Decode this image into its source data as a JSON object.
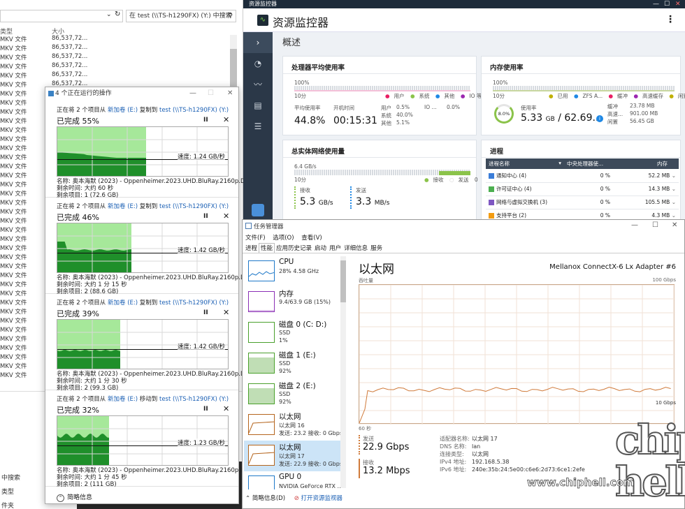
{
  "explorer": {
    "search_placeholder": "在 test (\\\\TS-h1290FX) (Y:) 中搜索",
    "col_type": "类型",
    "col_size": "大小",
    "file_type": "MKV 文件",
    "file_size": "86,537,72...",
    "left_labels": [
      "中搜索",
      "类型",
      "件夹"
    ]
  },
  "copy": {
    "title": "4 个正在运行的操作",
    "ops": [
      {
        "line_a": "正在将 2 个项目从 ",
        "src": "新加卷 (E:)",
        "verb": " 复制到 ",
        "dst": "test (\\\\TS-h1290FX) (Y:)",
        "pct": "已完成 55%",
        "progress": 0.55,
        "speed": "速度: 1.24 GB/秒",
        "name": "名称: 奥本海默 (2023) - Oppenheimer.2023.UHD.BluRay.2160p.DTS-...",
        "remain_time": "剩余时间: 大约 60 秒",
        "remain_items": "剩余项目: 1 (72.6 GB)"
      },
      {
        "line_a": "正在将 2 个项目从 ",
        "src": "新加卷 (E:)",
        "verb": " 复制到 ",
        "dst": "test (\\\\TS-h1290FX) (Y:)",
        "pct": "已完成 46%",
        "progress": 0.46,
        "speed": "速度: 1.42 GB/秒",
        "name": "名称: 奥本海默 (2023) - Oppenheimer.2023.UHD.BluRay.2160p.DTS-...",
        "remain_time": "剩余时间: 大约 1 分 15 秒",
        "remain_items": "剩余项目: 2 (88.6 GB)"
      },
      {
        "line_a": "正在将 2 个项目从 ",
        "src": "新加卷 (E:)",
        "verb": " 复制到 ",
        "dst": "test (\\\\TS-h1290FX) (Y:)",
        "pct": "已完成 39%",
        "progress": 0.39,
        "speed": "速度: 1.42 GB/秒",
        "name": "名称: 奥本海默 (2023) - Oppenheimer.2023.UHD.BluRay.2160p.DTS-...",
        "remain_time": "剩余时间: 大约 1 分 30 秒",
        "remain_items": "剩余项目: 2 (99.3 GB)"
      },
      {
        "line_a": "正在将 2 个项目从 ",
        "src": "新加卷 (E:)",
        "verb": " 移动到 ",
        "dst": "test (\\\\TS-h1290FX) (Y:)",
        "pct": "已完成 32%",
        "progress": 0.32,
        "speed": "速度: 1.23 GB/秒",
        "name": "名称: 奥本海默 (2023) - Oppenheimer.2023.UHD.BluRay.2160p.DTS-...",
        "remain_time": "剩余时间: 大约 1 分 45 秒",
        "remain_items": "剩余项目: 2 (111 GB)"
      }
    ],
    "pause_glyph": "II",
    "close_glyph": "✕",
    "footer": "简略信息"
  },
  "qnap": {
    "window_title": "资源监控器",
    "app_title": "资源监控器",
    "overview": "概述",
    "cpu": {
      "title": "处理器平均使用率",
      "top_pct": "100%",
      "sec": "10分",
      "zero": "0",
      "legend": [
        "用户",
        "系统",
        "其他",
        "IO 等待"
      ],
      "avg_label": "平均使用率",
      "avg_value": "44.8%",
      "uptime_label": "开机时间",
      "uptime_value": "00:15:31",
      "user_label": "用户",
      "user_value": "0.5%",
      "sys_label": "系统",
      "sys_value": "40.0%",
      "other_label": "其他",
      "other_value": "5.1%",
      "io_label": "IO ...",
      "io_value": "0.0%"
    },
    "mem": {
      "title": "内存使用率",
      "top_pct": "100%",
      "sec": "10分",
      "zero": "0",
      "legend": [
        "已用",
        "ZFS A...",
        "缓冲",
        "高速缓存",
        "闲置"
      ],
      "ring": "8.0%",
      "usage_label": "使用率",
      "used": "5.33",
      "used_unit": "GB",
      "total": "/ 62.69...",
      "buffer_label": "缓冲",
      "buffer_value": "23.78 MB",
      "cache_label": "高速...",
      "cache_value": "901.00 MB",
      "free_label": "闲置",
      "free_value": "56.45 GB"
    },
    "net": {
      "title": "总实体网络使用量",
      "top": "6.4 GB/s",
      "sec": "10分",
      "legend_rx": "接收",
      "legend_tx": "发送",
      "zero": "0",
      "rx_label": "接收",
      "rx_value": "5.3",
      "rx_unit": "GB/s",
      "tx_label": "发送",
      "tx_value": "3.3",
      "tx_unit": "MB/s"
    },
    "proc": {
      "title": "进程",
      "h_name": "进程名称",
      "h_cpu": "中央处理器使...",
      "h_mem": "内存",
      "rows": [
        {
          "name": "通知中心 (4)",
          "cpu": "0 %",
          "mem": "52.2 MB"
        },
        {
          "name": "许可证中心 (4)",
          "cpu": "0 %",
          "mem": "14.3 MB"
        },
        {
          "name": "网络与虚拟交换机 (3)",
          "cpu": "0 %",
          "mem": "105.5 MB"
        },
        {
          "name": "支持平台 (2)",
          "cpu": "0 %",
          "mem": "4.3 MB"
        }
      ]
    }
  },
  "taskmgr": {
    "title": "任务管理器",
    "menu": [
      "文件(F)",
      "选项(O)",
      "查看(V)"
    ],
    "tabs": [
      "进程",
      "性能",
      "应用历史记录",
      "启动",
      "用户",
      "详细信息",
      "服务"
    ],
    "active_tab": 1,
    "items": [
      {
        "n1": "CPU",
        "n2": "28%  4.58 GHz",
        "n3": "",
        "color": "#1e78c8"
      },
      {
        "n1": "内存",
        "n2": "9.4/63.9 GB (15%)",
        "n3": "",
        "color": "#8b2fb5"
      },
      {
        "n1": "磁盘 0 (C: D:)",
        "n2": "SSD",
        "n3": "1%",
        "color": "#4aa02c"
      },
      {
        "n1": "磁盘 1 (E:)",
        "n2": "SSD",
        "n3": "92%",
        "color": "#4aa02c"
      },
      {
        "n1": "磁盘 2 (E:)",
        "n2": "SSD",
        "n3": "92%",
        "color": "#4aa02c"
      },
      {
        "n1": "以太网",
        "n2": "以太网 16",
        "n3": "发送: 23.2 接收: 0 Gbps",
        "color": "#b5651d"
      },
      {
        "n1": "以太网",
        "n2": "以太网 17",
        "n3": "发送: 22.9 接收: 0 Gbps",
        "color": "#b5651d"
      },
      {
        "n1": "GPU 0",
        "n2": "NVIDIA GeForce RTX ...",
        "n3": "12% (40 °C)",
        "color": "#1e78c8"
      }
    ],
    "detail": {
      "title": "以太网",
      "adapter": "Mellanox ConnectX-6 Lx Adapter #6",
      "throughput": "吞吐量",
      "max": "100 Gbps",
      "mid": "10 Gbps",
      "sec60": "60 秒",
      "zero": "0",
      "send_label": "发送",
      "send_value": "22.9 Gbps",
      "recv_label": "接收",
      "recv_value": "13.2 Mbps",
      "kv": [
        {
          "k": "适配器名称:",
          "v": "以太网 17"
        },
        {
          "k": "DNS 名称:",
          "v": "lan"
        },
        {
          "k": "连接类型:",
          "v": "以太网"
        },
        {
          "k": "IPv4 地址:",
          "v": "192.168.5.38"
        },
        {
          "k": "IPv6 地址:",
          "v": "240e:35b:24:5e00:c6e6:2d73:6ce1:2efe"
        }
      ]
    },
    "footer_brief": "简略信息(D)",
    "footer_link": "打开资源监视器"
  },
  "watermark": {
    "logo": "chip hell",
    "url": "www.chiphell.com"
  },
  "colors": {
    "copy_fill": "#a6e89a",
    "copy_dark": "#1f8f2a",
    "qnap_side": "#2b3848",
    "tm_accent": "#b5651d"
  }
}
